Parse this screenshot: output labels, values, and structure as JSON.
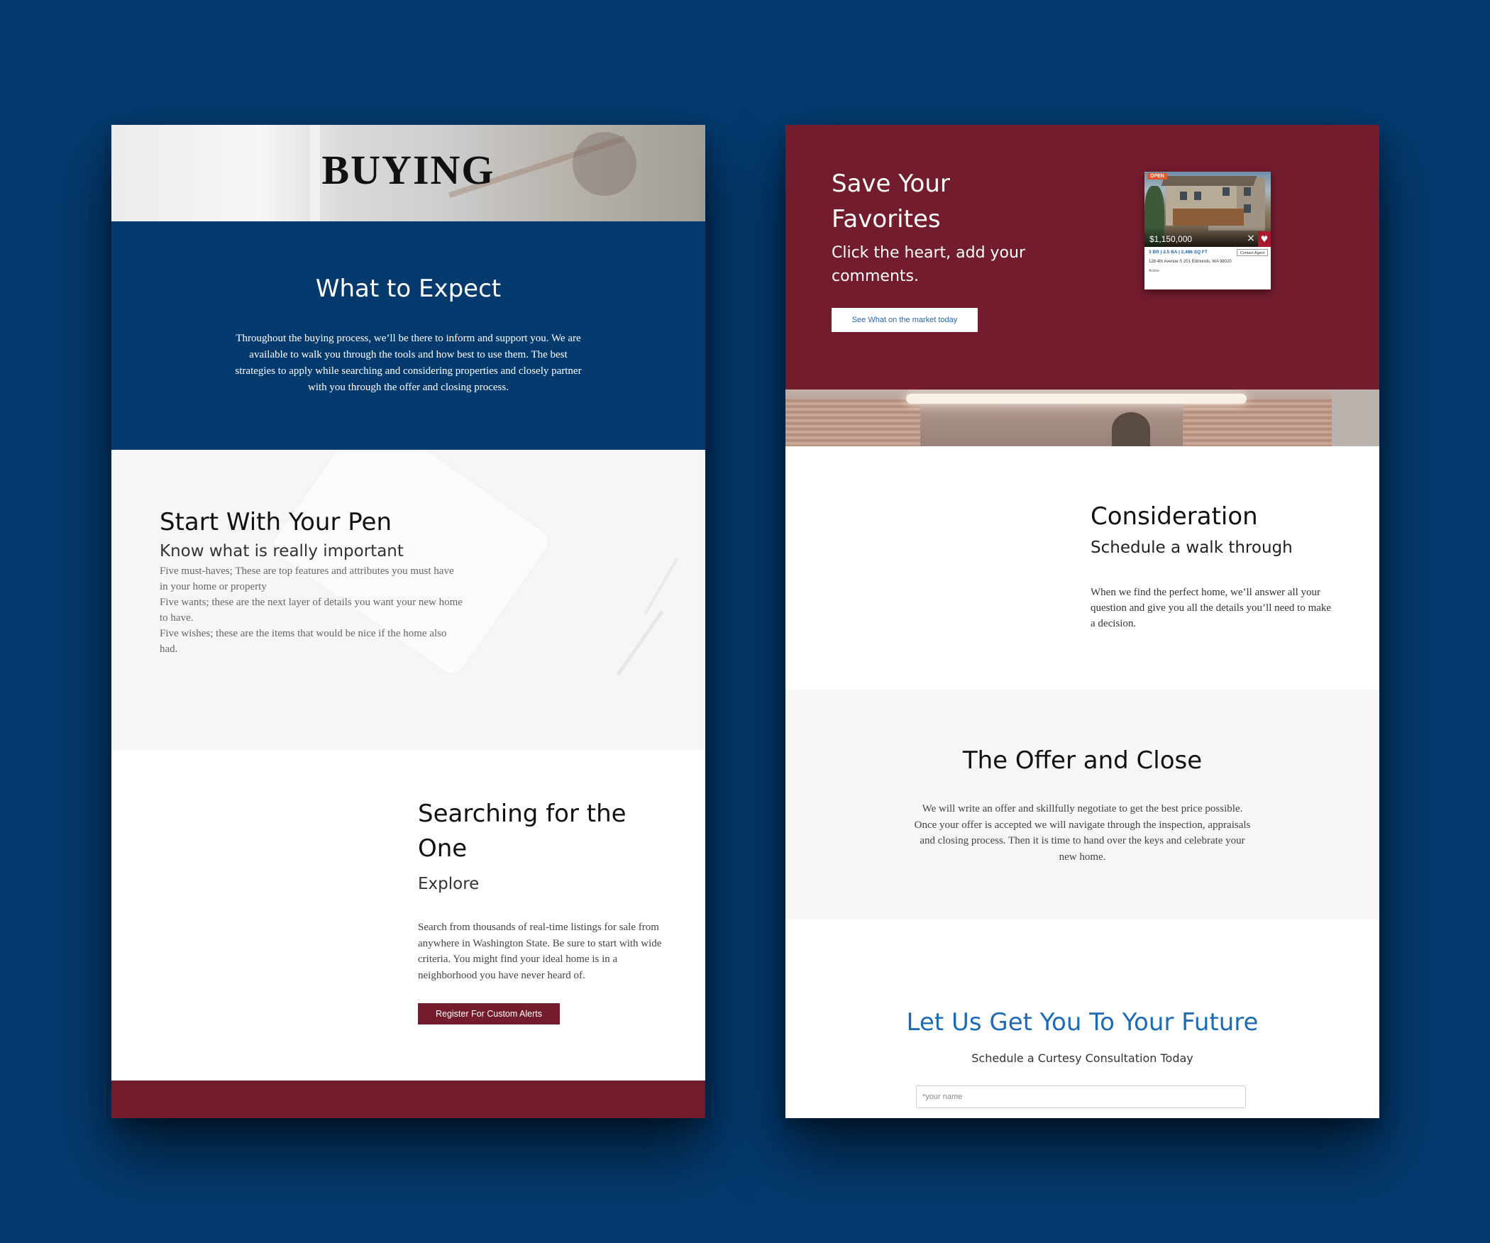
{
  "left_page": {
    "hero": {
      "title": "BUYING"
    },
    "expect": {
      "title": "What to Expect",
      "body": "Throughout the buying process, we’ll be there to inform and support you. We are available to walk you through the tools and how best to use them. The best strategies to apply while searching and considering properties and closely partner with you through the offer and closing process."
    },
    "pen": {
      "title": "Start With Your Pen",
      "subtitle": "Know what is really important",
      "paragraphs": [
        "Five must-haves; These are top features and attributes you must have in your home or property",
        "Five wants; these are the next layer of details you want your new home to have.",
        "Five wishes; these are the items that would be nice if the home also had."
      ]
    },
    "search": {
      "title": "Searching for the One",
      "subtitle": "Explore",
      "body": "Search from thousands of real-time listings for sale from anywhere in Washington State. Be sure to start with wide criteria. You might find your ideal home is in a neighborhood you have never heard of.",
      "button_label": "Register For Custom Alerts"
    }
  },
  "right_page": {
    "favorites": {
      "title": "Save Your Favorites",
      "subtitle": "Click the heart, add your comments.",
      "button_label": "See What on the market today",
      "card": {
        "badge": "OPEN",
        "price": "$1,150,000",
        "close_icon": "×",
        "heart_icon": "♥",
        "stats": "3 BR | 2.5 BA | 2,486 SQ FT",
        "contact_label": "Contact Agent",
        "address": "128 4th Avenue S 201 Edmonds, WA 98020",
        "status": "Active"
      }
    },
    "consideration": {
      "title": "Consideration",
      "subtitle": "Schedule a walk through",
      "body": "When we find the perfect home, we’ll answer all your question and give you all the details you’ll need to make a decision."
    },
    "offer": {
      "title": "The Offer and Close",
      "body": "We will write an offer and skillfully negotiate to get the best price possible. Once your offer is accepted we will navigate through the inspection, appraisals and closing process. Then it is time to hand over the keys and celebrate your new home."
    },
    "future": {
      "title": "Let Us Get You To Your Future",
      "subtitle": "Schedule a Curtesy Consultation Today",
      "name_placeholder": "*your name"
    }
  },
  "colors": {
    "background": "#043a6e",
    "navy": "#043a6e",
    "maroon": "#731c2e",
    "accent_blue": "#1d6bb5",
    "light_gray": "#f6f6f6"
  }
}
